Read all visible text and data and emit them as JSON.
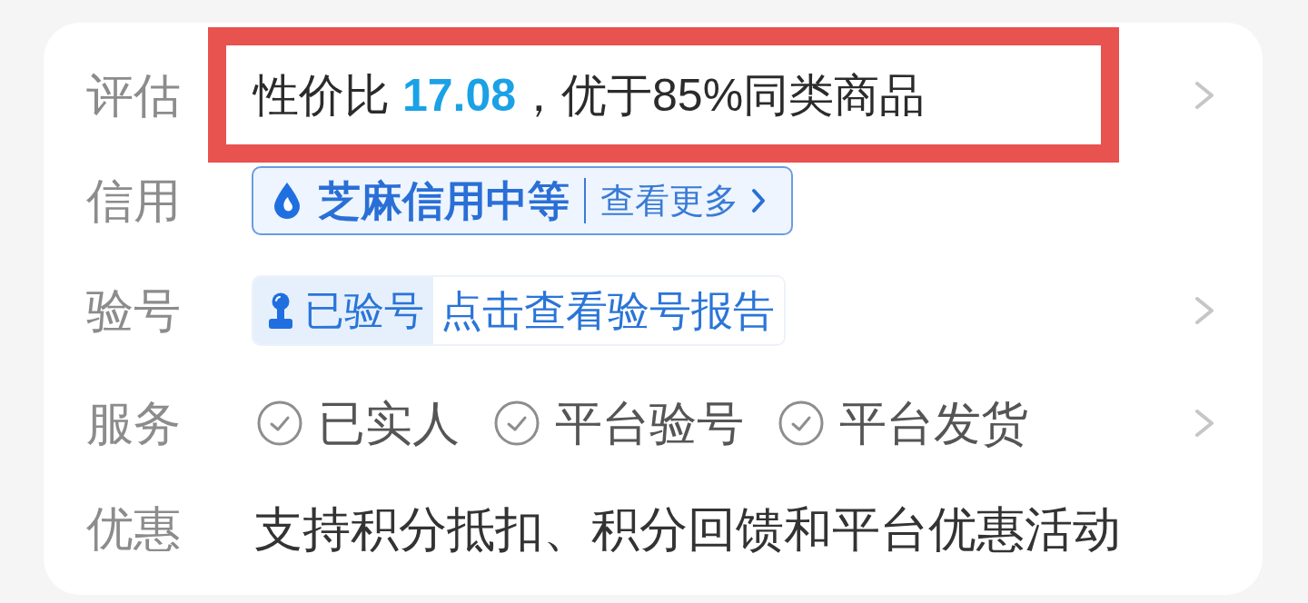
{
  "rows": [
    {
      "kind": "score",
      "label": "评估",
      "value": "性价比 **17.08**，优于85%同类商品",
      "highlighted": true,
      "arrow": true
    },
    {
      "kind": "credit",
      "label": "信用",
      "rating": "芝麻信用中等",
      "link": "查看更多",
      "arrow": false
    },
    {
      "kind": "verify",
      "label": "验号",
      "status": "已验号",
      "link": "点击查看验号报告",
      "arrow": true
    },
    {
      "kind": "services",
      "label": "服务",
      "items": [
        "已实人",
        "平台验号",
        "平台发货"
      ],
      "arrow": true
    },
    {
      "kind": "text",
      "label": "优惠",
      "value": "支持积分抵扣、积分回馈和平台优惠活动",
      "arrow": false
    }
  ]
}
